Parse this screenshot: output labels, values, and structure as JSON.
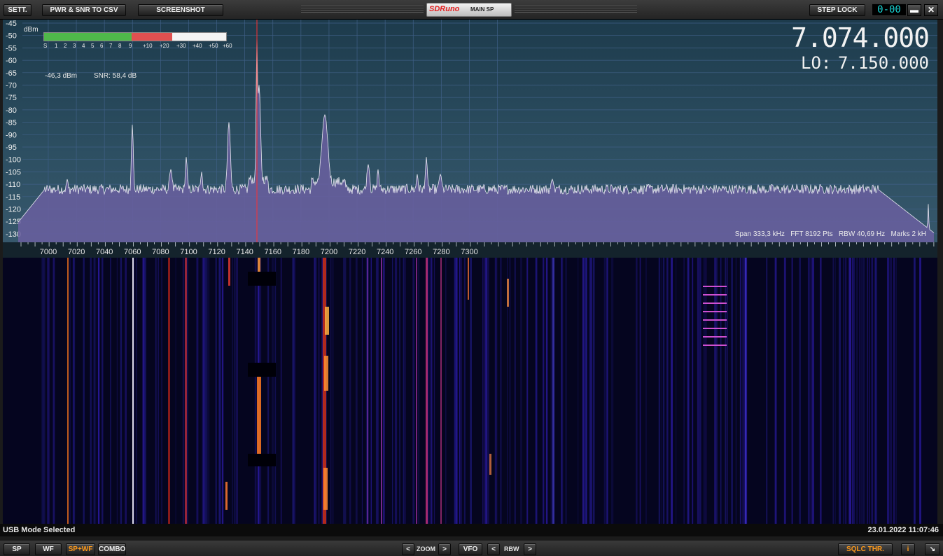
{
  "toolbar": {
    "sett_label": "SETT.",
    "pwr_csv_label": "PWR & SNR TO CSV",
    "screenshot_label": "SCREENSHOT",
    "logo_text": "SDRuno",
    "panel_name": "MAIN SP",
    "step_lock_label": "STEP LOCK",
    "step_display": "0-00",
    "minimize_symbol": "▬",
    "close_symbol": "✕"
  },
  "spectrum": {
    "y_unit": "dBm",
    "y_ticks": [
      "-45",
      "-50",
      "-55",
      "-60",
      "-65",
      "-70",
      "-75",
      "-80",
      "-85",
      "-90",
      "-95",
      "-100",
      "-105",
      "-110",
      "-115",
      "-120",
      "-125",
      "-130"
    ],
    "x_ticks": [
      "7000",
      "7020",
      "7040",
      "7060",
      "7080",
      "7100",
      "7120",
      "7140",
      "7160",
      "7180",
      "7200",
      "7220",
      "7240",
      "7260",
      "7280",
      "7300"
    ],
    "smeter_labels": [
      "S",
      "1",
      "2",
      "3",
      "4",
      "5",
      "6",
      "7",
      "8",
      "9",
      "+10",
      "+20",
      "+30",
      "+40",
      "+50",
      "+60"
    ],
    "smeter_level_fraction": 0.7,
    "power_readout": "-46,3 dBm",
    "snr_readout": "SNR: 58,4 dB",
    "vfo_frequency": "7.074.000",
    "lo_label": "LO:",
    "lo_frequency": "7.150.000",
    "span_info": "Span 333,3 kHz",
    "fft_info": "FFT 8192 Pts",
    "rbw_info": "RBW 40,69 Hz",
    "marks_info": "Marks 2 kH",
    "colors": {
      "fill": "#6a5fa0",
      "trace": "#e8e8f0",
      "marker": "#ff3030",
      "background": "#254456"
    }
  },
  "status": {
    "mode_text": "USB Mode Selected",
    "datetime": "23.01.2022 11:07:46"
  },
  "bottom": {
    "sp_label": "SP",
    "wf_label": "WF",
    "spwf_label": "SP+WF",
    "combo_label": "COMBO",
    "zoom_label": "ZOOM",
    "vfo_label": "VFO",
    "rbw_label": "RBW",
    "sqlc_label": "SQLC THR.",
    "info_label": "i",
    "left_arrow": "<",
    "right_arrow": ">",
    "resize_icon": "↘"
  }
}
